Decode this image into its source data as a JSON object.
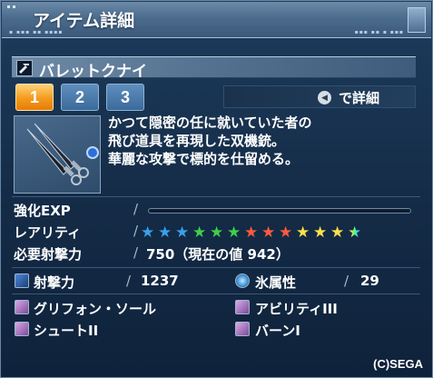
{
  "window": {
    "title": "アイテム詳細"
  },
  "weapon": {
    "name": "バレットクナイ",
    "icon": "twin-machine-gun-icon"
  },
  "tabs": [
    {
      "label": "1",
      "active": true
    },
    {
      "label": "2",
      "active": false
    },
    {
      "label": "3",
      "active": false
    }
  ],
  "detail_button": {
    "label": "で詳細",
    "icon": "button-prompt-icon"
  },
  "description": [
    "かつて隠密の任に就いていた者の",
    "飛び道具を再現した双機銃。",
    "華麗な攻撃で標的を仕留める。"
  ],
  "stats": {
    "exp_label": "強化EXP",
    "exp_separator": "/",
    "exp_fill": 0,
    "rarity_label": "レアリティ",
    "rarity_separator": "/",
    "rarity_stars": 13,
    "rarity_colors": [
      "#3aa0e8",
      "#3aa0e8",
      "#3aa0e8",
      "#3fcf4a",
      "#3fcf4a",
      "#3fcf4a",
      "#ff5a3c",
      "#ff5a3c",
      "#ff5a3c",
      "#ffe04a",
      "#ffe04a",
      "#ffe04a",
      "rainbow"
    ],
    "req_label": "必要射撃力",
    "req_separator": "/",
    "req_value": "750（現在の値 942）",
    "attack_label": "射撃力",
    "attack_separator": "/",
    "attack_value": "1237",
    "element_label": "氷属性",
    "element_separator": "/",
    "element_value": "29"
  },
  "affixes": [
    {
      "label": "グリフォン・ソール"
    },
    {
      "label": "アビリティIII"
    },
    {
      "label": "シュートII"
    },
    {
      "label": "バーンI"
    }
  ],
  "copyright": "(C)SEGA",
  "colors": {
    "active_tab": "#f59a1c",
    "inactive_tab": "#3b6a9b",
    "frame": "#142b46"
  }
}
